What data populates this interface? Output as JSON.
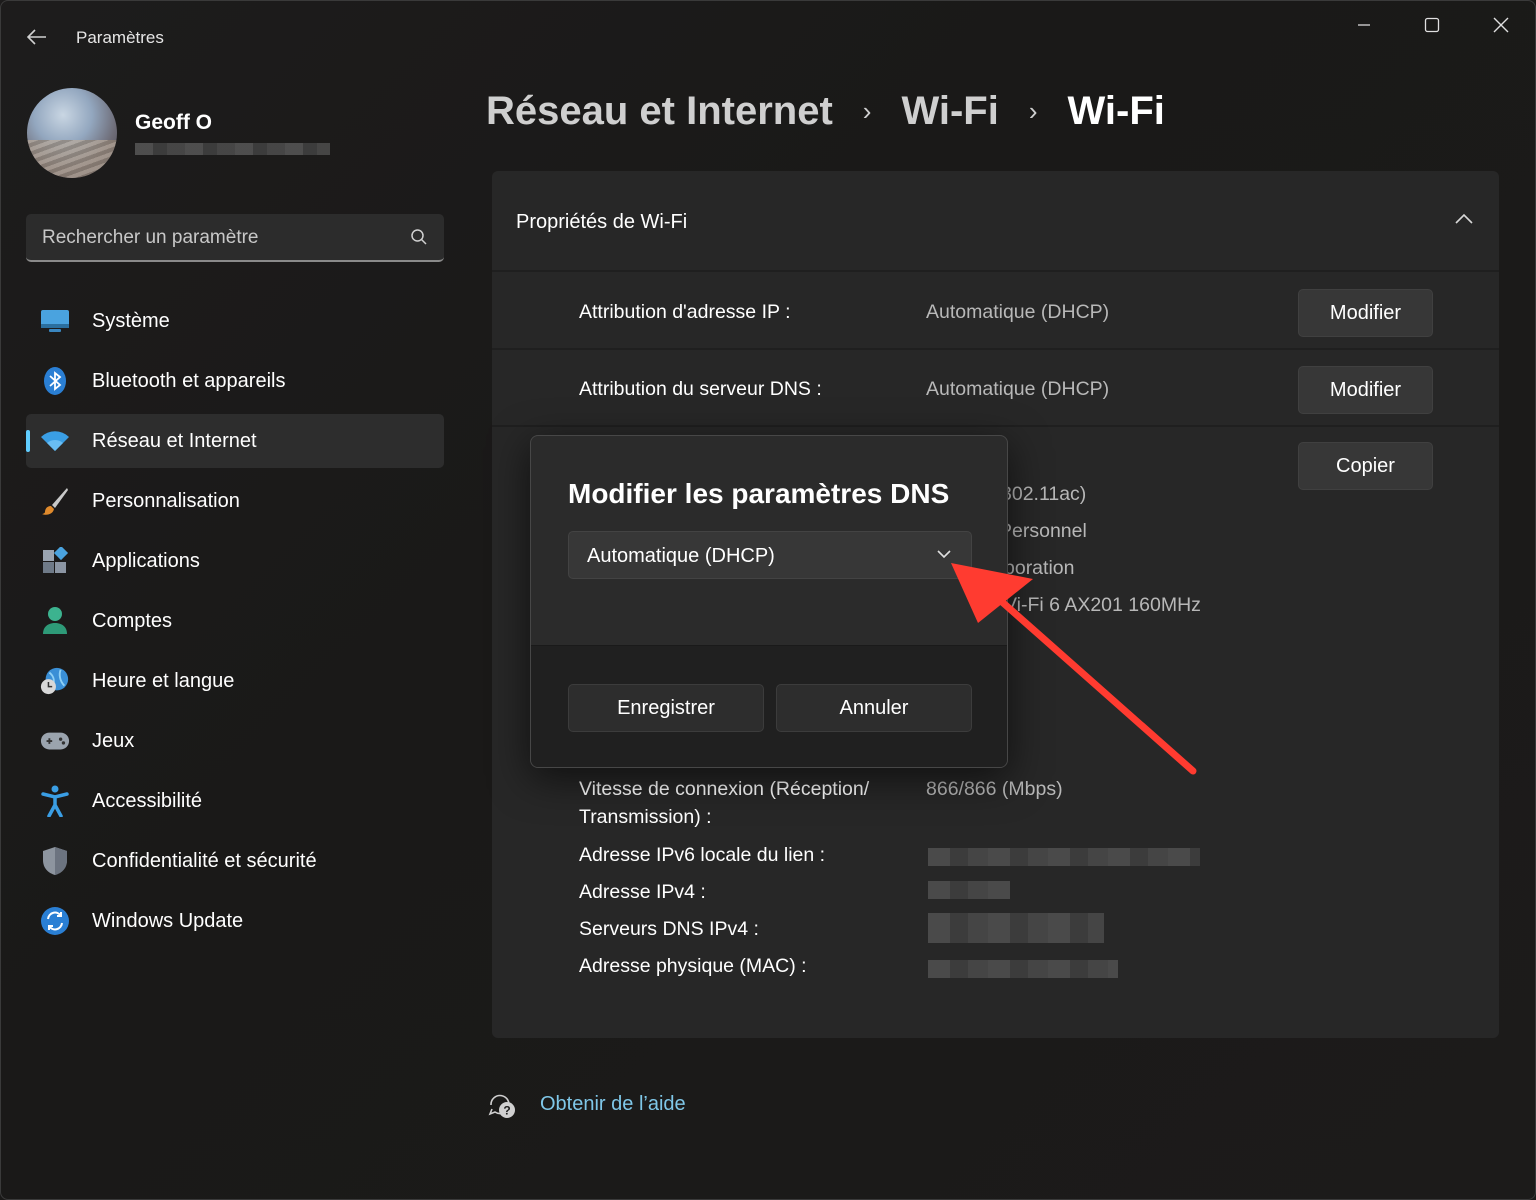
{
  "window": {
    "title": "Paramètres"
  },
  "profile": {
    "name": "Geoff O"
  },
  "search": {
    "placeholder": "Rechercher un paramètre"
  },
  "sidebar": {
    "items": [
      {
        "label": "Système",
        "icon": "monitor-icon"
      },
      {
        "label": "Bluetooth et appareils",
        "icon": "bluetooth-icon"
      },
      {
        "label": "Réseau et Internet",
        "icon": "wifi-icon",
        "active": true
      },
      {
        "label": "Personnalisation",
        "icon": "brush-icon"
      },
      {
        "label": "Applications",
        "icon": "apps-icon"
      },
      {
        "label": "Comptes",
        "icon": "person-icon"
      },
      {
        "label": "Heure et langue",
        "icon": "globe-clock-icon"
      },
      {
        "label": "Jeux",
        "icon": "gamepad-icon"
      },
      {
        "label": "Accessibilité",
        "icon": "accessibility-icon"
      },
      {
        "label": "Confidentialité et sécurité",
        "icon": "shield-icon"
      },
      {
        "label": "Windows Update",
        "icon": "update-icon"
      }
    ]
  },
  "breadcrumb": [
    "Réseau et Internet",
    "Wi-Fi",
    "Wi-Fi"
  ],
  "card": {
    "title": "Propriétés de Wi-Fi",
    "rows": [
      {
        "label": "Attribution d'adresse IP :",
        "value": "Automatique (DHCP)",
        "button": "Modifier"
      },
      {
        "label": "Attribution du serveur DNS :",
        "value": "Automatique (DHCP)",
        "button": "Modifier"
      }
    ],
    "copy_button": "Copier",
    "partial_values": [
      "302.11ac)",
      "Personnel",
      "poration",
      "Vi-Fi 6 AX201 160MHz"
    ],
    "props": [
      {
        "label": "Vitesse de connexion (Réception/",
        "label2": "Transmission) :",
        "value": "866/866 (Mbps)"
      },
      {
        "label": "Adresse IPv6 locale du lien :"
      },
      {
        "label": "Adresse IPv4 :"
      },
      {
        "label": "Serveurs DNS IPv4 :"
      },
      {
        "label": "Adresse physique (MAC) :"
      }
    ]
  },
  "help": {
    "label": "Obtenir de l’aide"
  },
  "dialog": {
    "title": "Modifier les paramètres DNS",
    "selected": "Automatique (DHCP)",
    "save": "Enregistrer",
    "cancel": "Annuler"
  },
  "colors": {
    "accent": "#60cdff",
    "annotation_arrow": "#ff3b30",
    "link": "#7fc7e8"
  }
}
